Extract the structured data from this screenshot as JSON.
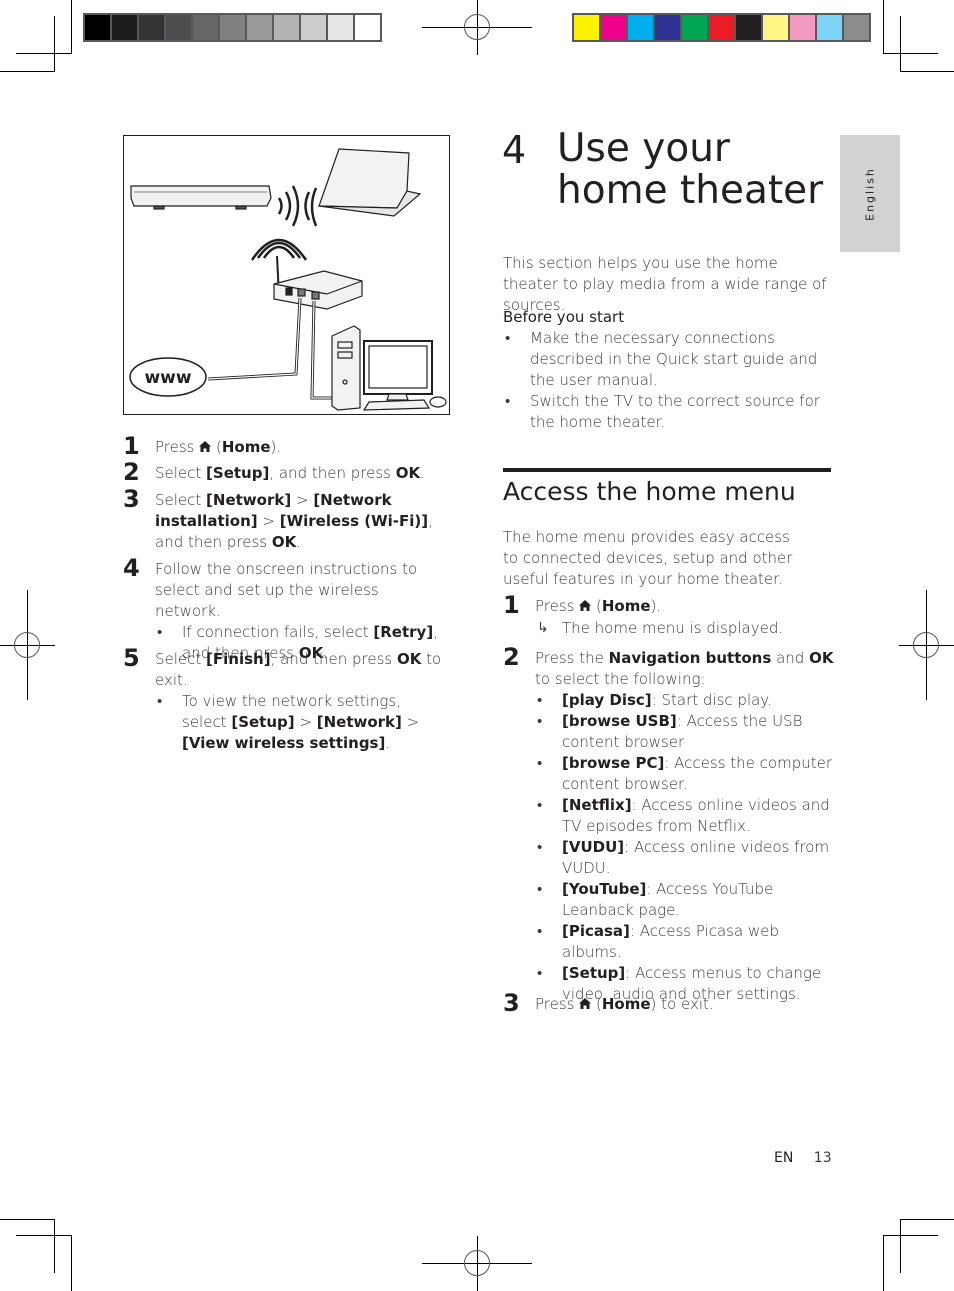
{
  "print_marks": {
    "grayscale_swatches": [
      "#000000",
      "#1c1c1c",
      "#333333",
      "#4d4d4d",
      "#666666",
      "#808080",
      "#999999",
      "#b3b3b3",
      "#cccccc",
      "#e6e6e6",
      "#ffffff"
    ],
    "color_swatches": [
      "#fff200",
      "#ec008c",
      "#00aeef",
      "#2e3192",
      "#00a651",
      "#ed1c24",
      "#231f20",
      "#fff685",
      "#f49ac1",
      "#7dd3f7",
      "#8c8c8c"
    ]
  },
  "side_tab": {
    "label": "English"
  },
  "figure": {
    "www_label": "www",
    "icons": [
      "home-theater-device-icon",
      "laptop-icon",
      "wireless-signal-icon",
      "wireless-router-icon",
      "desktop-computer-icon",
      "internet-www-icon"
    ]
  },
  "left_steps": [
    {
      "num": "1",
      "parts": [
        [
          "Press ",
          false
        ],
        [
          "⌂",
          "icon"
        ],
        [
          " (",
          false
        ],
        [
          "Home",
          true
        ],
        [
          ").",
          false
        ]
      ]
    },
    {
      "num": "2",
      "parts": [
        [
          "Select ",
          false
        ],
        [
          "[Setup]",
          true
        ],
        [
          ", and then press ",
          false
        ],
        [
          "OK",
          true
        ],
        [
          ".",
          false
        ]
      ]
    },
    {
      "num": "3",
      "parts": [
        [
          "Select ",
          false
        ],
        [
          "[Network]",
          true
        ],
        [
          " > ",
          false
        ],
        [
          "[Network installation]",
          true
        ],
        [
          " > ",
          false
        ],
        [
          "[Wireless (Wi-Fi)]",
          true
        ],
        [
          ", and then press ",
          false
        ],
        [
          "OK",
          true
        ],
        [
          ".",
          false
        ]
      ]
    },
    {
      "num": "4",
      "parts": [
        [
          "Follow the onscreen instructions to select and set up the wireless network.",
          false
        ]
      ],
      "bullets": [
        [
          [
            "If connection fails, select ",
            false
          ],
          [
            "[Retry]",
            true
          ],
          [
            ", and then press ",
            false
          ],
          [
            "OK",
            true
          ],
          [
            ".",
            false
          ]
        ]
      ]
    },
    {
      "num": "5",
      "parts": [
        [
          "Select ",
          false
        ],
        [
          "[Finish]",
          true
        ],
        [
          ", and then press ",
          false
        ],
        [
          "OK",
          true
        ],
        [
          " to exit.",
          false
        ]
      ],
      "bullets": [
        [
          [
            "To view the network settings, select ",
            false
          ],
          [
            "[Setup]",
            true
          ],
          [
            " > ",
            false
          ],
          [
            "[Network]",
            true
          ],
          [
            " > ",
            false
          ],
          [
            "[View wireless settings]",
            true
          ],
          [
            ".",
            false
          ]
        ]
      ]
    }
  ],
  "chapter": {
    "number": "4",
    "title": "Use your home theater",
    "intro": "This section helps you use the home theater to play media from a wide range of sources.",
    "before_heading": "Before you start",
    "before_bullets": [
      "Make the necessary connections described in the Quick start guide and the user manual.",
      "Switch the TV to the correct source for the home theater."
    ]
  },
  "section": {
    "title": "Access the home menu",
    "intro": "The home menu provides easy access to connected devices, setup and other useful features in your home theater.",
    "steps": [
      {
        "num": "1",
        "parts": [
          [
            "Press ",
            false
          ],
          [
            "⌂",
            "icon"
          ],
          [
            " (",
            false
          ],
          [
            "Home",
            true
          ],
          [
            ").",
            false
          ]
        ],
        "result": "The home menu is displayed."
      },
      {
        "num": "2",
        "parts": [
          [
            "Press the ",
            false
          ],
          [
            "Navigation buttons",
            true
          ],
          [
            " and ",
            false
          ],
          [
            "OK",
            true
          ],
          [
            " to select the following:",
            false
          ]
        ],
        "bullets": [
          [
            [
              "[play Disc]",
              true
            ],
            [
              ": Start disc play.",
              false
            ]
          ],
          [
            [
              "[browse USB]",
              true
            ],
            [
              ": Access the USB content browser",
              false
            ]
          ],
          [
            [
              "[browse PC]",
              true
            ],
            [
              ": Access the computer content browser.",
              false
            ]
          ],
          [
            [
              "[Netflix]",
              true
            ],
            [
              ": Access online videos and TV episodes from Netflix.",
              false
            ]
          ],
          [
            [
              "[VUDU]",
              true
            ],
            [
              ": Access online videos from VUDU.",
              false
            ]
          ],
          [
            [
              "[YouTube]",
              true
            ],
            [
              ": Access YouTube Leanback page.",
              false
            ]
          ],
          [
            [
              "[Picasa]",
              true
            ],
            [
              ": Access Picasa web albums.",
              false
            ]
          ],
          [
            [
              "[Setup]",
              true
            ],
            [
              ": Access menus to change video, audio and other settings.",
              false
            ]
          ]
        ]
      },
      {
        "num": "3",
        "parts": [
          [
            "Press ",
            false
          ],
          [
            "⌂",
            "icon"
          ],
          [
            " (",
            false
          ],
          [
            "Home",
            true
          ],
          [
            ") to exit.",
            false
          ]
        ]
      }
    ]
  },
  "footer": {
    "lang": "EN",
    "page": "13"
  }
}
